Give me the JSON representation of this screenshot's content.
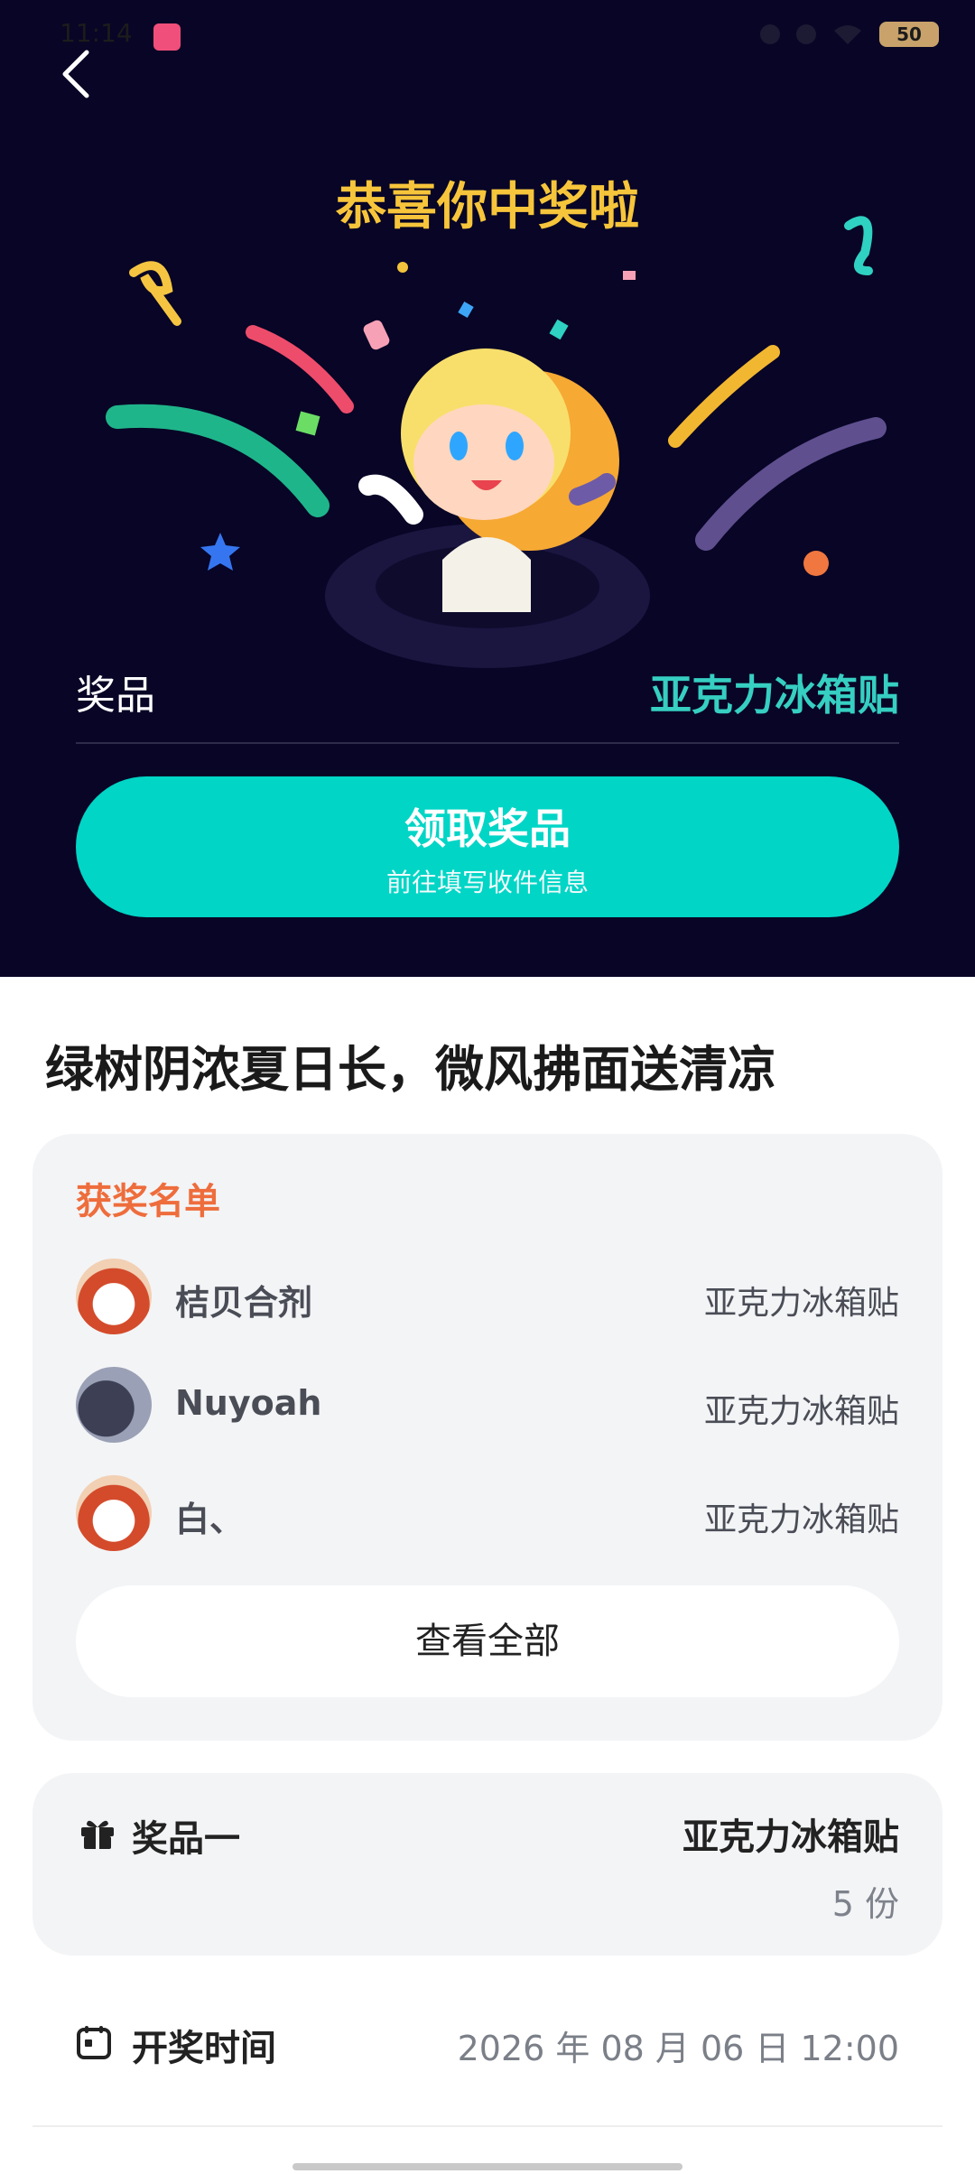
{
  "status_bar": {
    "time": "11:14",
    "battery": "50"
  },
  "header": {
    "title": "恭喜你中奖啦"
  },
  "prize_summary": {
    "label": "奖品",
    "value": "亚克力冰箱贴"
  },
  "claim_button": {
    "title": "领取奖品",
    "subtitle": "前往填写收件信息"
  },
  "headline": "绿树阴浓夏日长，微风拂面送清凉",
  "winners": {
    "title": "获奖名单",
    "items": [
      {
        "name": "桔贝合剂",
        "prize": "亚克力冰箱贴"
      },
      {
        "name": "Nuyoah",
        "prize": "亚克力冰箱贴"
      },
      {
        "name": "白、",
        "prize": "亚克力冰箱贴"
      }
    ],
    "view_all_label": "查看全部"
  },
  "prize_detail": {
    "label": "奖品一",
    "name": "亚克力冰箱贴",
    "count": "5 份"
  },
  "draw_time": {
    "label": "开奖时间",
    "value": "2026 年 08 月 06 日 12:00"
  },
  "colors": {
    "top_background": "#080526",
    "title": "#f7c53b",
    "accent": "#00d5c6",
    "prize_value": "#36cfc2",
    "winners_title": "#ee6d3c"
  }
}
